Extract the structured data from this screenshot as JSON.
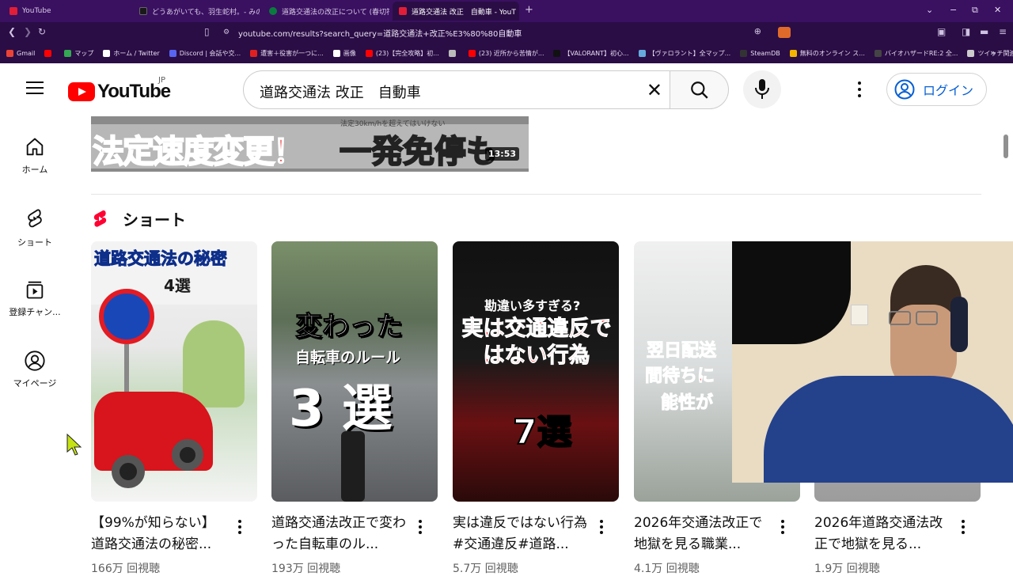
{
  "browser": {
    "tabs": [
      {
        "label": "YouTube",
        "active": false,
        "color": "#e01e37"
      },
      {
        "label": "どうあがいても、羽生蛇村。- みの作書店",
        "active": false,
        "color": "#1a1a1a"
      },
      {
        "label": "道路交通法の改正について (春切符に",
        "active": false,
        "color": "#0b7a3e"
      },
      {
        "label": "道路交通法 改正　自動車 - YouT",
        "active": true,
        "color": "#e01e37"
      }
    ],
    "new_tab_glyph": "+",
    "window_controls": [
      "⌄",
      "−",
      "⧉",
      "✕"
    ],
    "url": "youtube.com/results?search_query=道路交通法+改正%E3%80%80自動車",
    "bookmarks": [
      {
        "label": "Gmail",
        "color": "#ea4335"
      },
      {
        "label": "",
        "color": "#ff0000"
      },
      {
        "label": "マップ",
        "color": "#34a853"
      },
      {
        "label": "ホーム / Twitter",
        "color": "#ffffff"
      },
      {
        "label": "Discord | 会話や交...",
        "color": "#5865f2"
      },
      {
        "label": "遭害＋役害が一つに...",
        "color": "#e02020"
      },
      {
        "label": "画像",
        "color": "#ffffff"
      },
      {
        "label": "(23)【完全攻略】初...",
        "color": "#ff0000"
      },
      {
        "label": "",
        "color": "#bbbbbb"
      },
      {
        "label": "(23) 近所から苦情が...",
        "color": "#ff0000"
      },
      {
        "label": "【VALORANT】初心...",
        "color": "#111111"
      },
      {
        "label": "【ヴァロラント】全マップ...",
        "color": "#66aadd"
      },
      {
        "label": "SteamDB",
        "color": "#333333"
      },
      {
        "label": "無料のオンライン ス...",
        "color": "#f4b400"
      },
      {
        "label": "バイオハザードRE:2 全...",
        "color": "#444444"
      },
      {
        "label": "ツイッチ関連",
        "color": "#cccccc"
      }
    ],
    "bookmarks_more": "»"
  },
  "header": {
    "logo_text": "YouTube",
    "country_code": "JP",
    "search_value": "道路交通法 改正　自動車",
    "login_label": "ログイン"
  },
  "sidebar": {
    "items": [
      {
        "label": "ホーム",
        "icon": "home-icon"
      },
      {
        "label": "ショート",
        "icon": "shorts-icon"
      },
      {
        "label": "登録チャン...",
        "icon": "subscriptions-icon"
      },
      {
        "label": "マイページ",
        "icon": "account-icon"
      }
    ]
  },
  "top_video": {
    "thumb_text_left": "法定速度変更！",
    "thumb_text_right": "一発免停も",
    "thumb_small_text": "法定30km/hを超えてはいけない",
    "duration": "13:53"
  },
  "shorts": {
    "heading": "ショート",
    "items": [
      {
        "title": "【99%が知らない】道路交通法の秘密...",
        "views": "166万 回視聴",
        "overlay_a": "道路交通法の秘密",
        "overlay_b": "4選",
        "overlay_c": ""
      },
      {
        "title": "道路交通法改正で変わった自転車のル...",
        "views": "193万 回視聴",
        "overlay_a": "変わった",
        "overlay_b": "自転車のルール",
        "overlay_c": "3 選"
      },
      {
        "title": "実は違反ではない行為#交通違反#道路...",
        "views": "5.7万 回視聴",
        "overlay_a": "勘違い多すぎる?",
        "overlay_b": "実は交通違反ではない行為",
        "overlay_c": "7選"
      },
      {
        "title": "2026年交通法改正で地獄を見る職業...",
        "views": "4.1万 回視聴",
        "overlay_a": "翌日配送",
        "overlay_b": "間待ちに",
        "overlay_c": "能性が"
      },
      {
        "title": "2026年道路交通法改正で地獄を見る...",
        "views": "1.9万 回視聴",
        "overlay_a": "",
        "overlay_b": "",
        "overlay_c": ""
      }
    ]
  },
  "colors": {
    "brand_red": "#ff0000",
    "link_blue": "#065fd4",
    "browser_purple": "#2a0d45"
  }
}
